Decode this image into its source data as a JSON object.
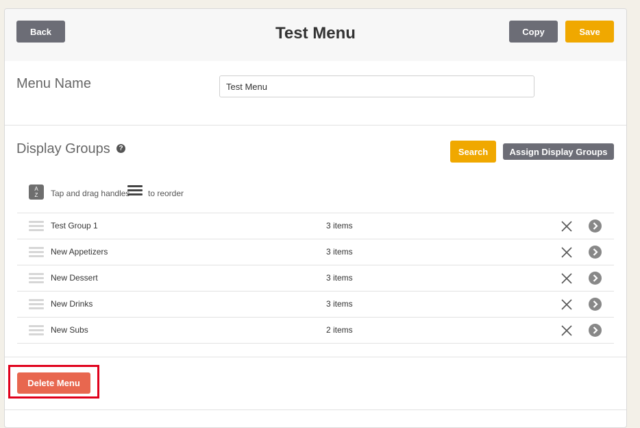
{
  "header": {
    "back_label": "Back",
    "title": "Test Menu",
    "copy_label": "Copy",
    "save_label": "Save"
  },
  "menu_name": {
    "label": "Menu Name",
    "value": "Test Menu"
  },
  "display_groups": {
    "label": "Display Groups",
    "help_icon": "?",
    "search_label": "Search",
    "assign_label": "Assign Display Groups",
    "sort_icon_top": "A",
    "sort_icon_bottom": "Z",
    "hint_prefix": "Tap and drag handles",
    "hint_suffix": "to reorder",
    "rows": [
      {
        "name": "Test Group 1",
        "count": "3 items"
      },
      {
        "name": "New Appetizers",
        "count": "3 items"
      },
      {
        "name": "New Dessert",
        "count": "3 items"
      },
      {
        "name": "New Drinks",
        "count": "3 items"
      },
      {
        "name": "New Subs",
        "count": "2 items"
      }
    ]
  },
  "footer": {
    "delete_label": "Delete Menu"
  },
  "colors": {
    "primary_gray": "#6c6d76",
    "accent_yellow": "#f0a800",
    "danger_red": "#e8674f",
    "highlight_red": "#e0001b"
  },
  "icons": [
    "help-icon",
    "sort-az-icon",
    "hamburger-icon",
    "drag-handle-icon",
    "close-icon",
    "chevron-right-icon"
  ]
}
